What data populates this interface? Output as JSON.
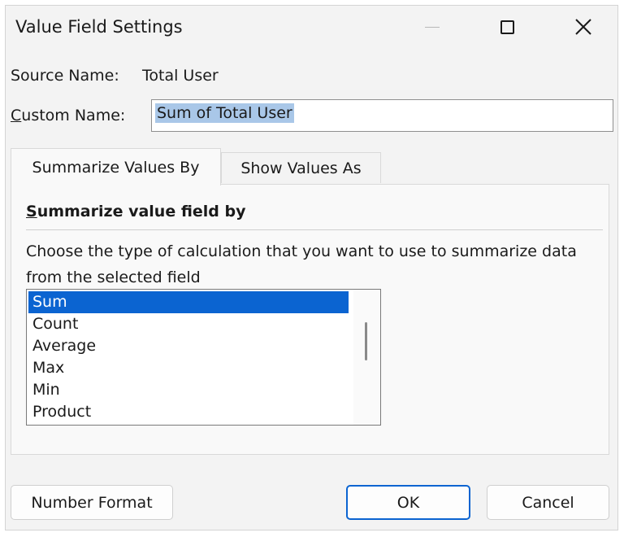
{
  "window": {
    "title": "Value Field Settings"
  },
  "source": {
    "label": "Source Name:",
    "value": "Total User"
  },
  "custom_name": {
    "label": "Custom Name:",
    "value": "Sum of Total User"
  },
  "tabs": [
    {
      "label": "Summarize Values By",
      "active": true
    },
    {
      "label": "Show Values As",
      "active": false
    }
  ],
  "panel": {
    "heading": "Summarize value field by",
    "description": "Choose the type of calculation that you want to use to summarize data from the selected field",
    "list_items": [
      "Sum",
      "Count",
      "Average",
      "Max",
      "Min",
      "Product"
    ],
    "selected_index": 0
  },
  "buttons": {
    "number_format": "Number Format",
    "ok": "OK",
    "cancel": "Cancel"
  },
  "colors": {
    "selection": "#0b64d1",
    "text_highlight": "#a9c7e8",
    "dialog_bg": "#f3f3f3"
  },
  "icons": {
    "minimize": "minimize-icon",
    "maximize": "maximize-icon",
    "close": "close-icon"
  }
}
